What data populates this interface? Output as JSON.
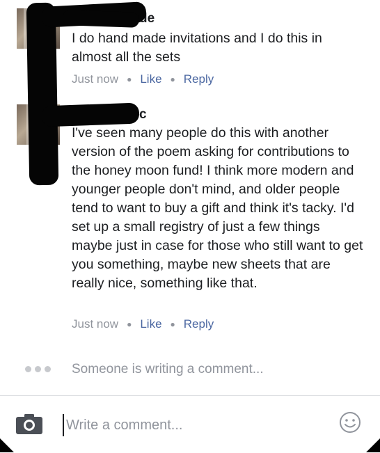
{
  "comments": [
    {
      "author": "de",
      "text": "I do hand made invitations and I do this in almost all the sets",
      "time": "Just now",
      "like_label": "Like",
      "reply_label": "Reply"
    },
    {
      "author": "c",
      "text": "I've seen many people do this with another version of the poem asking for contributions to the honey moon fund! I think more modern and younger people don't mind, and older people tend to want to buy a gift and think it's tacky. I'd set up a small registry of just a few things maybe just in case for those who still want to get you something, maybe new sheets that are really nice, something like that.",
      "time": "Just now",
      "like_label": "Like",
      "reply_label": "Reply"
    }
  ],
  "typing_indicator": {
    "text": "Someone is writing a comment..."
  },
  "composer": {
    "placeholder": "Write a comment...",
    "camera_icon": "camera-icon",
    "emoji_icon": "smiley-icon"
  },
  "colors": {
    "text": "#1c1e21",
    "meta": "#90949c",
    "link": "#4b67a1",
    "redaction": "#050505"
  }
}
